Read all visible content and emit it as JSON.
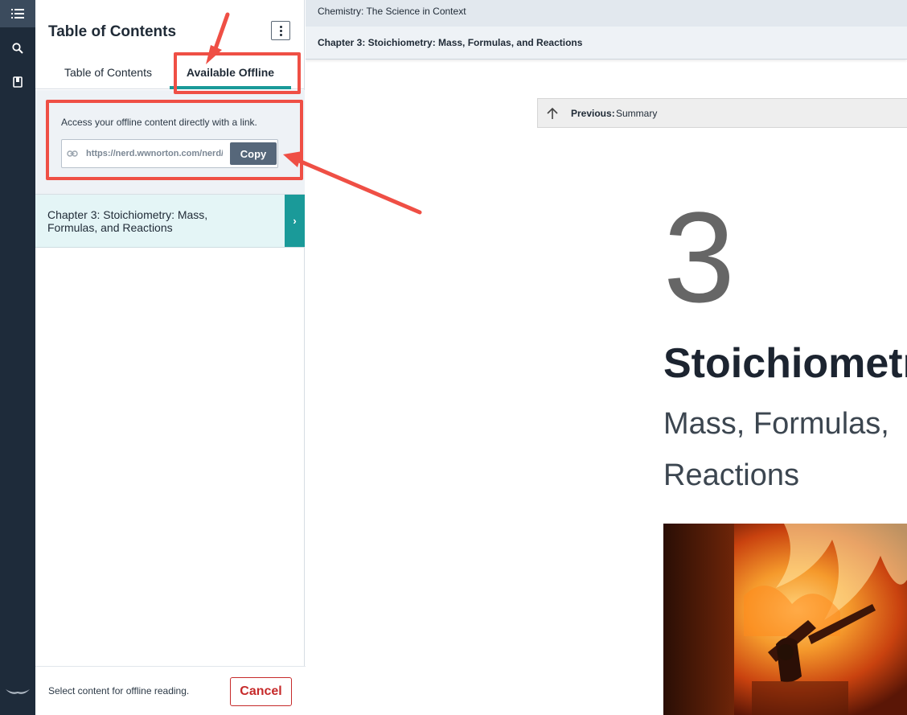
{
  "rail": {
    "icons": [
      "list-icon",
      "search-icon",
      "bookmark-icon",
      "norton-logo"
    ]
  },
  "sidebar": {
    "title": "Table of Contents",
    "tabs": [
      {
        "label": "Table of Contents",
        "active": false
      },
      {
        "label": "Available Offline",
        "active": true
      }
    ],
    "offline": {
      "description": "Access your offline content directly with a link.",
      "link_value": "https://nerd.wwnorton.com/nerd/",
      "copy_label": "Copy"
    },
    "chapter_item": {
      "label": "Chapter 3: Stoichiometry: Mass, Formulas, and Reactions",
      "arrow": "›"
    },
    "footer": {
      "text": "Select content for offline reading.",
      "cancel_label": "Cancel"
    }
  },
  "main": {
    "breadcrumb_book": "Chemistry: The Science in Context",
    "breadcrumb_chapter": "Chapter 3: Stoichiometry: Mass, Formulas, and Reactions",
    "previous": {
      "label": "Previous:",
      "value": "Summary"
    },
    "chapter_number": "3",
    "chapter_title": "Stoichiometr",
    "chapter_subtitle_line1": "Mass, Formulas,",
    "chapter_subtitle_line2": "Reactions"
  },
  "colors": {
    "rail_bg": "#1e2b3a",
    "teal_accent": "#1a9a99",
    "annotation_red": "#ef4f45",
    "cancel_red": "#c62a2a",
    "copy_button": "#56677a"
  }
}
